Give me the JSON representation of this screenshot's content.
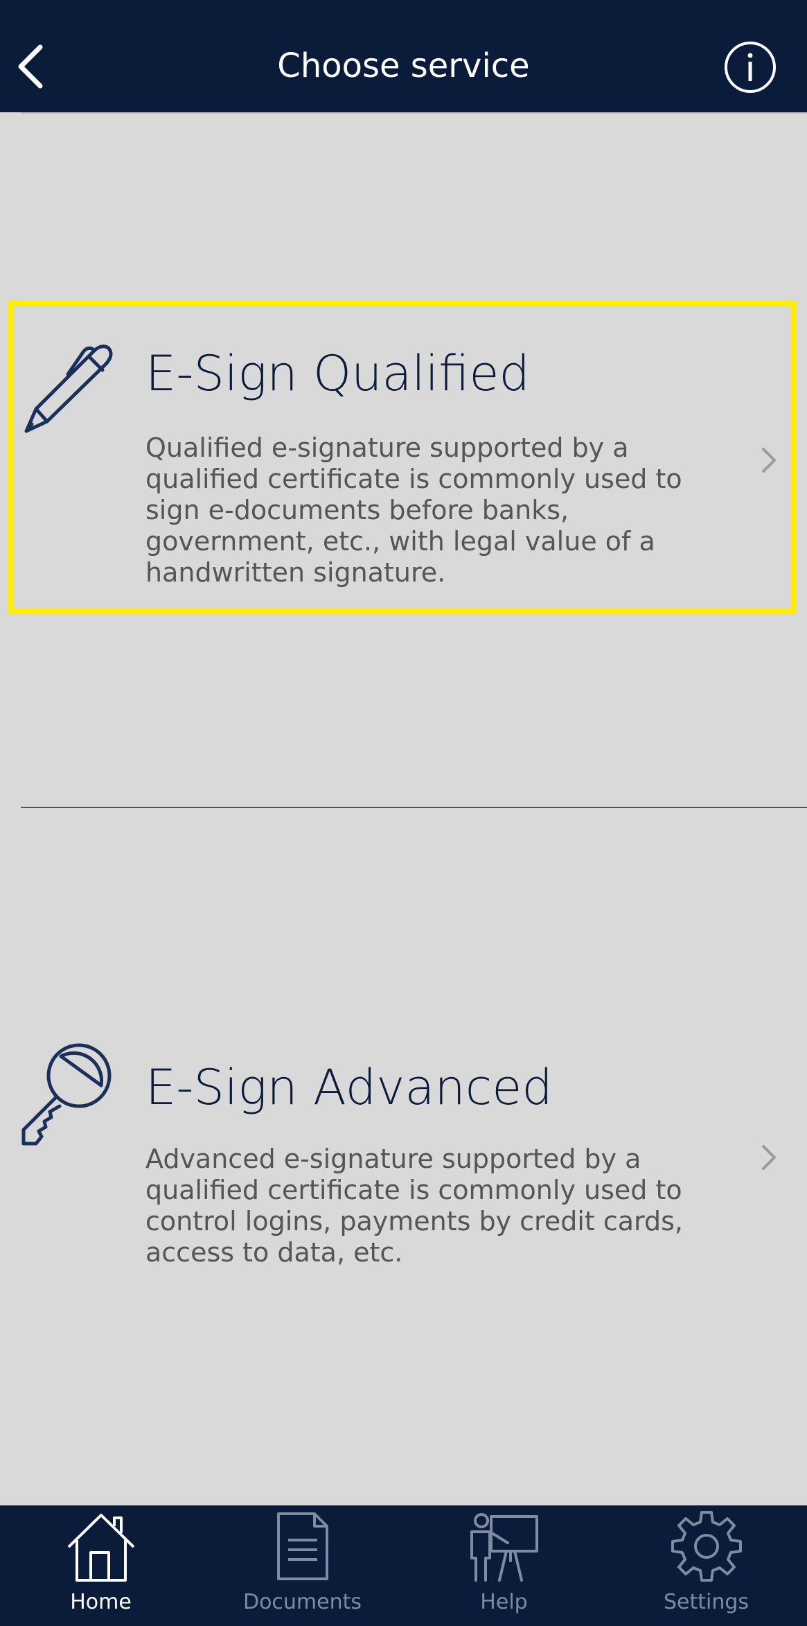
{
  "header": {
    "title": "Choose service",
    "back_icon": "chevron-left-icon",
    "info_icon": "info-icon"
  },
  "colors": {
    "navy": "#0b1b3a",
    "background": "#d9d9d9",
    "highlight": "#ffee00",
    "muted_tab": "#7f8ba3"
  },
  "services": [
    {
      "title": "E-Sign Qualified",
      "description": "Qualified e-signature supported by a qualified certificate is commonly used to sign e-documents before banks, government, etc., with legal value of a handwritten signature.",
      "icon": "pen-icon"
    },
    {
      "title": "E-Sign Advanced",
      "description": "Advanced e-signature supported by a qualified certificate is commonly used to control logins, payments by credit cards, access to data, etc.",
      "icon": "key-icon"
    }
  ],
  "tabs": [
    {
      "label": "Home",
      "icon": "home-icon",
      "active": true
    },
    {
      "label": "Documents",
      "icon": "document-icon",
      "active": false
    },
    {
      "label": "Help",
      "icon": "presenter-icon",
      "active": false
    },
    {
      "label": "Settings",
      "icon": "gear-icon",
      "active": false
    }
  ]
}
